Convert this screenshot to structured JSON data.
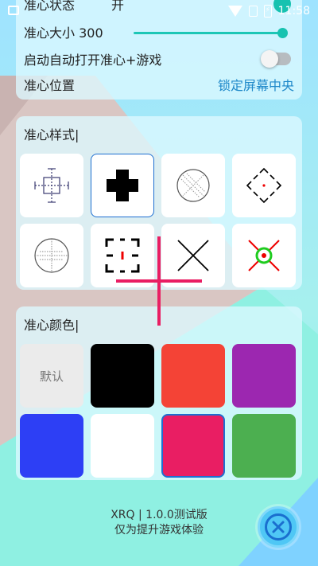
{
  "status_bar": {
    "time": "11:58",
    "battery_glyph": "⚡"
  },
  "settings": {
    "status_label": "准心状态",
    "status_value": "开",
    "size_label": "准心大小 300",
    "autostart_label": "启动自动打开准心+游戏",
    "position_label": "准心位置",
    "position_action": "锁定屏幕中央"
  },
  "style_section": {
    "title": "准心样式|",
    "styles": [
      {
        "icon": "dotted-crosshair-icon",
        "selected": false
      },
      {
        "icon": "bold-plus-icon",
        "selected": true
      },
      {
        "icon": "dotted-circle-icon",
        "selected": false
      },
      {
        "icon": "diamond-brackets-icon",
        "selected": false
      },
      {
        "icon": "scope-circle-icon",
        "selected": false
      },
      {
        "icon": "corner-brackets-icon",
        "selected": false
      },
      {
        "icon": "x-cross-icon",
        "selected": false
      },
      {
        "icon": "green-ring-red-x-icon",
        "selected": false
      }
    ]
  },
  "color_section": {
    "title": "准心颜色|",
    "default_label": "默认",
    "colors": [
      "#ebebeb",
      "#000000",
      "#f44336",
      "#9c27b0",
      "#2d3ff5",
      "#ffffff",
      "#e91e63",
      "#4caf50"
    ],
    "selected_index": 6
  },
  "footer": {
    "version": "XRQ | 1.0.0测试版",
    "tagline": "仅为提升游戏体验"
  },
  "overlay": {
    "color": "#e91e63"
  }
}
